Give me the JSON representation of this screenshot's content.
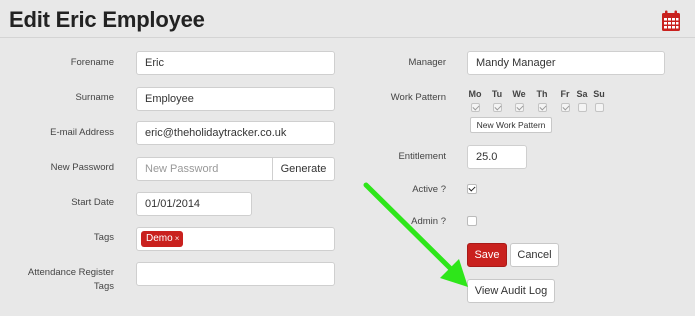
{
  "page": {
    "title": "Edit Eric Employee",
    "calendar_icon": "calendar-icon"
  },
  "left_form": {
    "forename": {
      "label": "Forename",
      "value": "Eric"
    },
    "surname": {
      "label": "Surname",
      "value": "Employee"
    },
    "email": {
      "label": "E-mail Address",
      "value": "eric@theholidaytracker.co.uk"
    },
    "password": {
      "label": "New Password",
      "placeholder": "New Password",
      "generate_label": "Generate"
    },
    "start_date": {
      "label": "Start Date",
      "value": "01/01/2014"
    },
    "tags": {
      "label": "Tags",
      "items": [
        "Demo"
      ],
      "remove_glyph": "×"
    },
    "attendance": {
      "label_line1": "Attendance Register",
      "label_line2": "Tags",
      "value": ""
    }
  },
  "right_form": {
    "manager": {
      "label": "Manager",
      "value": "Mandy Manager"
    },
    "work_pattern": {
      "label": "Work Pattern",
      "days": [
        {
          "label": "Mo",
          "checked": true
        },
        {
          "label": "Tu",
          "checked": true
        },
        {
          "label": "We",
          "checked": true
        },
        {
          "label": "Th",
          "checked": true
        },
        {
          "label": "Fr",
          "checked": true
        },
        {
          "label": "Sa",
          "checked": false
        },
        {
          "label": "Su",
          "checked": false
        }
      ],
      "new_button": "New Work Pattern"
    },
    "entitlement": {
      "label": "Entitlement",
      "value": "25.0"
    },
    "active": {
      "label": "Active ?",
      "checked": true
    },
    "admin": {
      "label": "Admin ?",
      "checked": false
    },
    "save_label": "Save",
    "cancel_label": "Cancel",
    "audit_label": "View Audit Log"
  },
  "colors": {
    "accent": "#c9211e",
    "annotation_arrow": "#2ee61a"
  }
}
